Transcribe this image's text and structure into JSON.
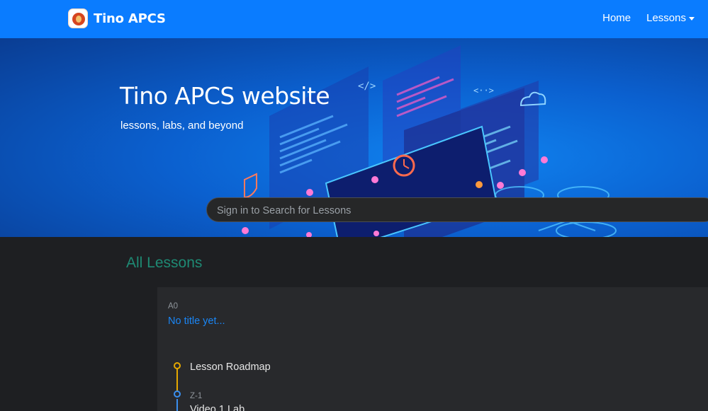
{
  "navbar": {
    "brand": "Tino APCS",
    "links": [
      {
        "label": "Home"
      },
      {
        "label": "Lessons",
        "has_dropdown": true
      }
    ],
    "bg_color": "#0a7cff"
  },
  "hero": {
    "title": "Tino APCS website",
    "subtitle": "lessons, labs, and beyond",
    "search_placeholder": "Sign in to Search for Lessons"
  },
  "section": {
    "title": "All Lessons",
    "title_color": "#1e8a74"
  },
  "lessons": [
    {
      "code": "A0",
      "title": "No title yet...",
      "timeline": [
        {
          "label": "Lesson Roadmap",
          "color": "#e6a800"
        },
        {
          "code": "Z-1",
          "label": "Video 1 Lab",
          "color": "#3a8ff0"
        }
      ]
    }
  ]
}
